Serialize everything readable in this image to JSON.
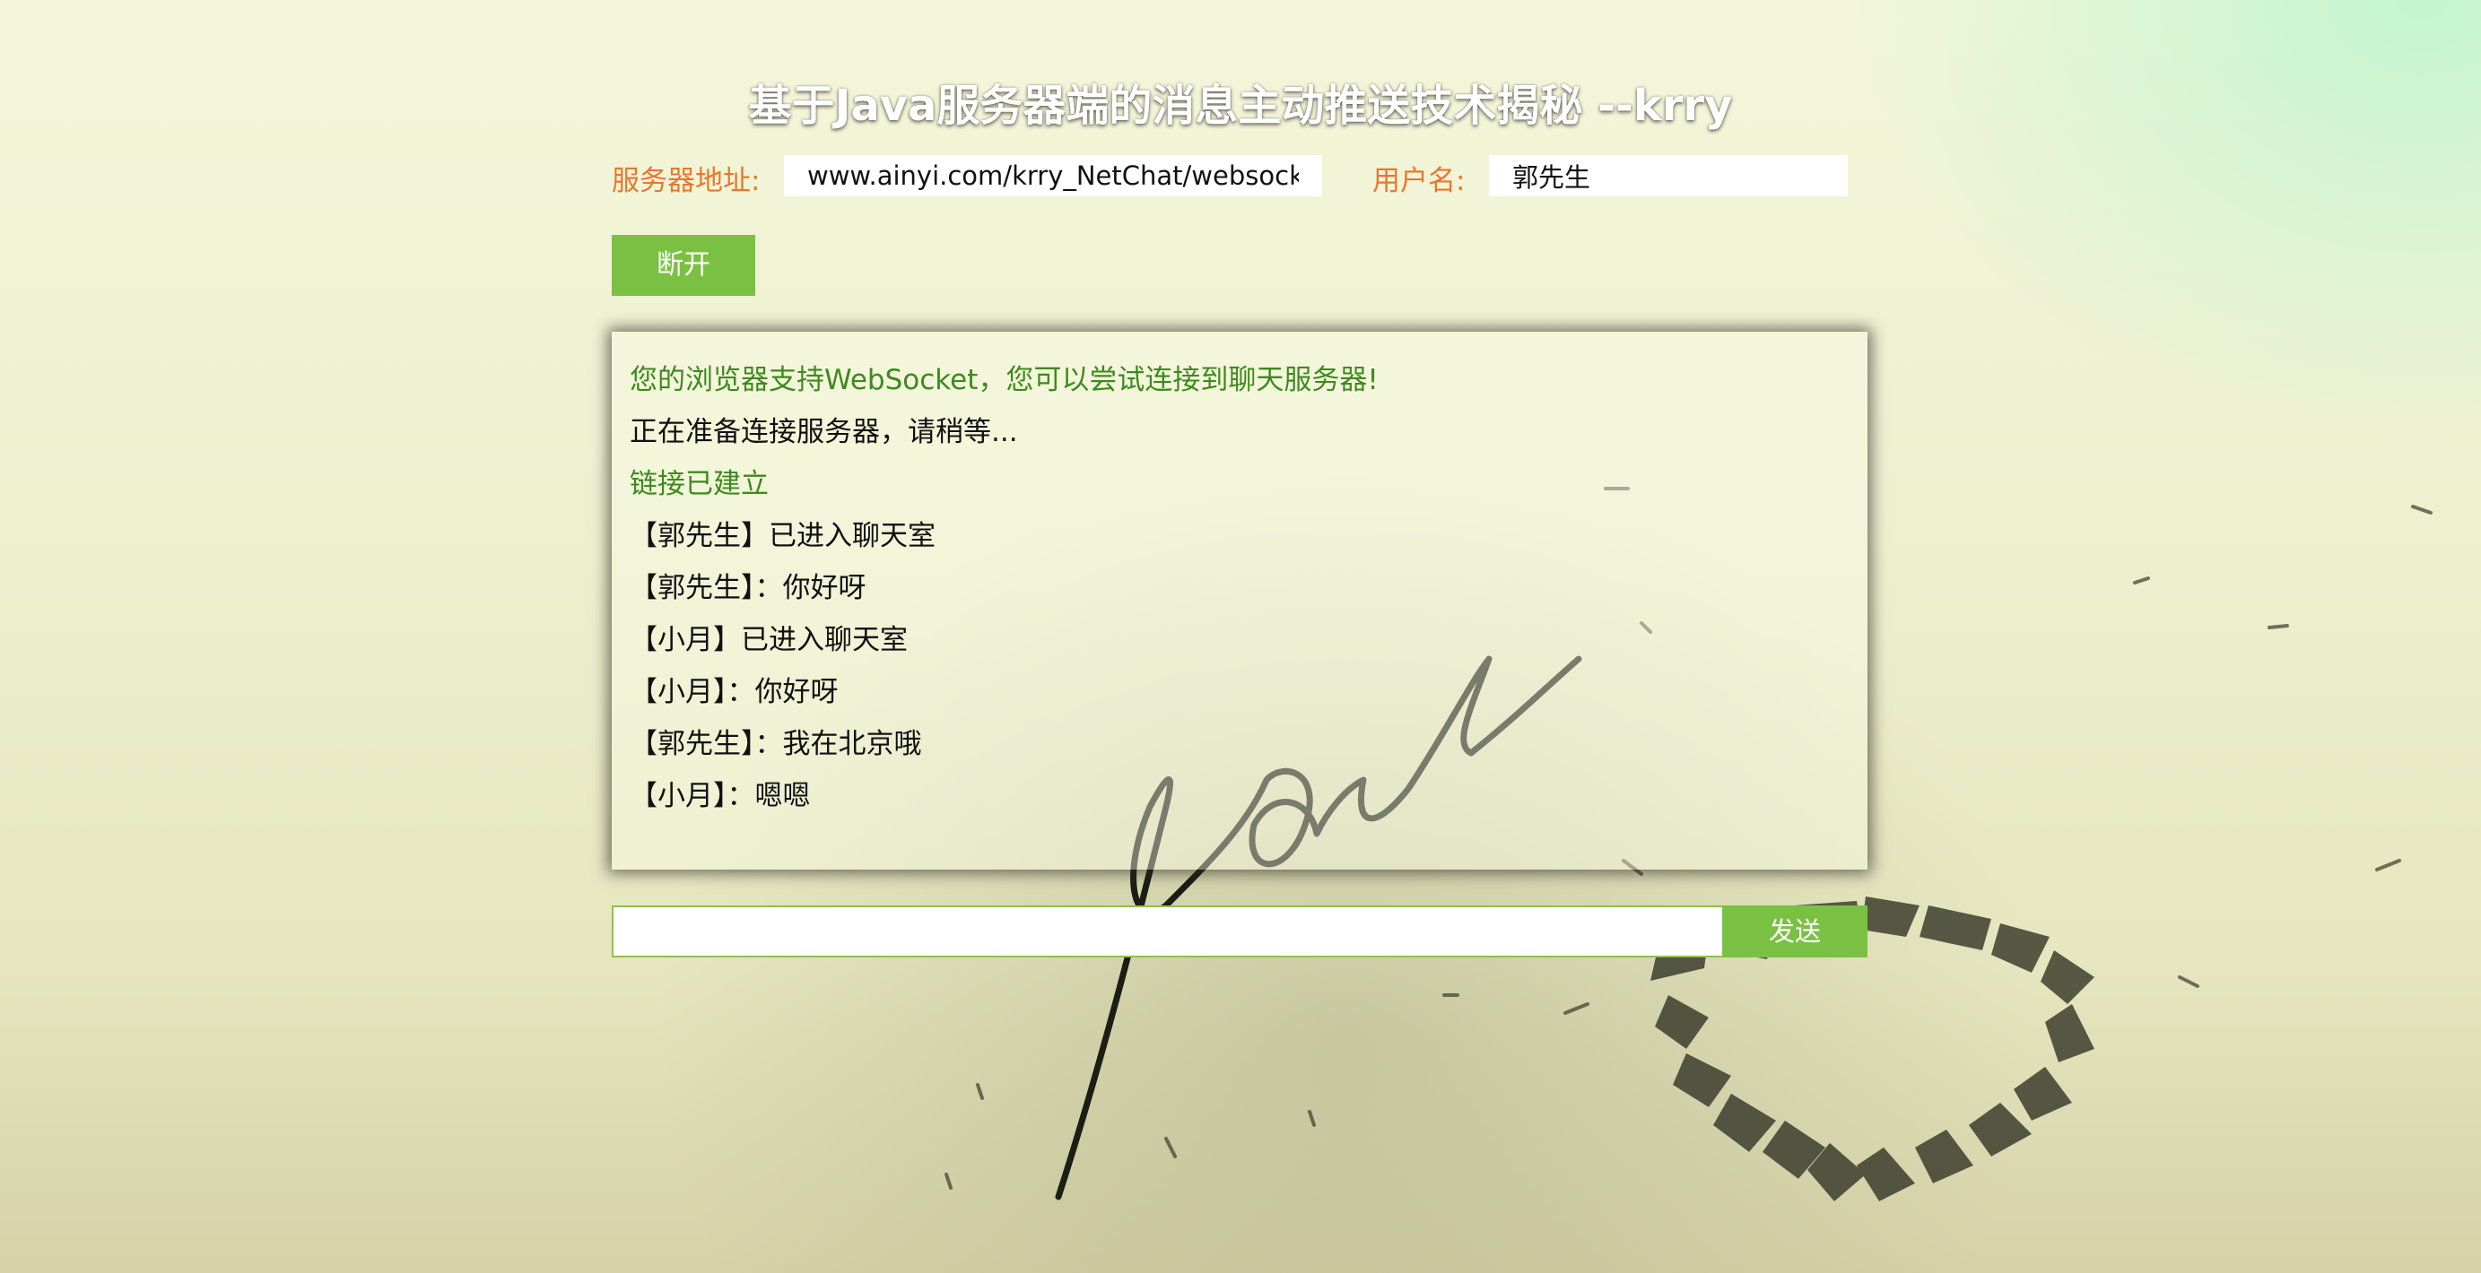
{
  "header": {
    "title": "基于Java服务器端的消息主动推送技术揭秘 --krry"
  },
  "connection": {
    "server_label": "服务器地址:",
    "server_value": "www.ainyi.com/krry_NetChat/websocket",
    "user_label": "用户名:",
    "user_value": "郭先生",
    "disconnect_label": "断开"
  },
  "chat": {
    "messages": [
      {
        "text": "您的浏览器支持WebSocket，您可以尝试连接到聊天服务器!",
        "type": "system"
      },
      {
        "text": "正在准备连接服务器，请稍等...",
        "type": "info"
      },
      {
        "text": "链接已建立",
        "type": "system"
      },
      {
        "text": "【郭先生】已进入聊天室",
        "type": "info"
      },
      {
        "text": "【郭先生】：你好呀",
        "type": "info"
      },
      {
        "text": "【小月】已进入聊天室",
        "type": "info"
      },
      {
        "text": "【小月】：你好呀",
        "type": "info"
      },
      {
        "text": "【郭先生】：我在北京哦",
        "type": "info"
      },
      {
        "text": "【小月】：嗯嗯",
        "type": "info"
      }
    ]
  },
  "composer": {
    "input_value": "",
    "send_label": "发送"
  },
  "colors": {
    "accent_green": "#7ac143",
    "label_orange": "#e8772e",
    "system_text": "#3d8a1e"
  },
  "background": {
    "decoration": "handwritten-love-heart-art"
  }
}
